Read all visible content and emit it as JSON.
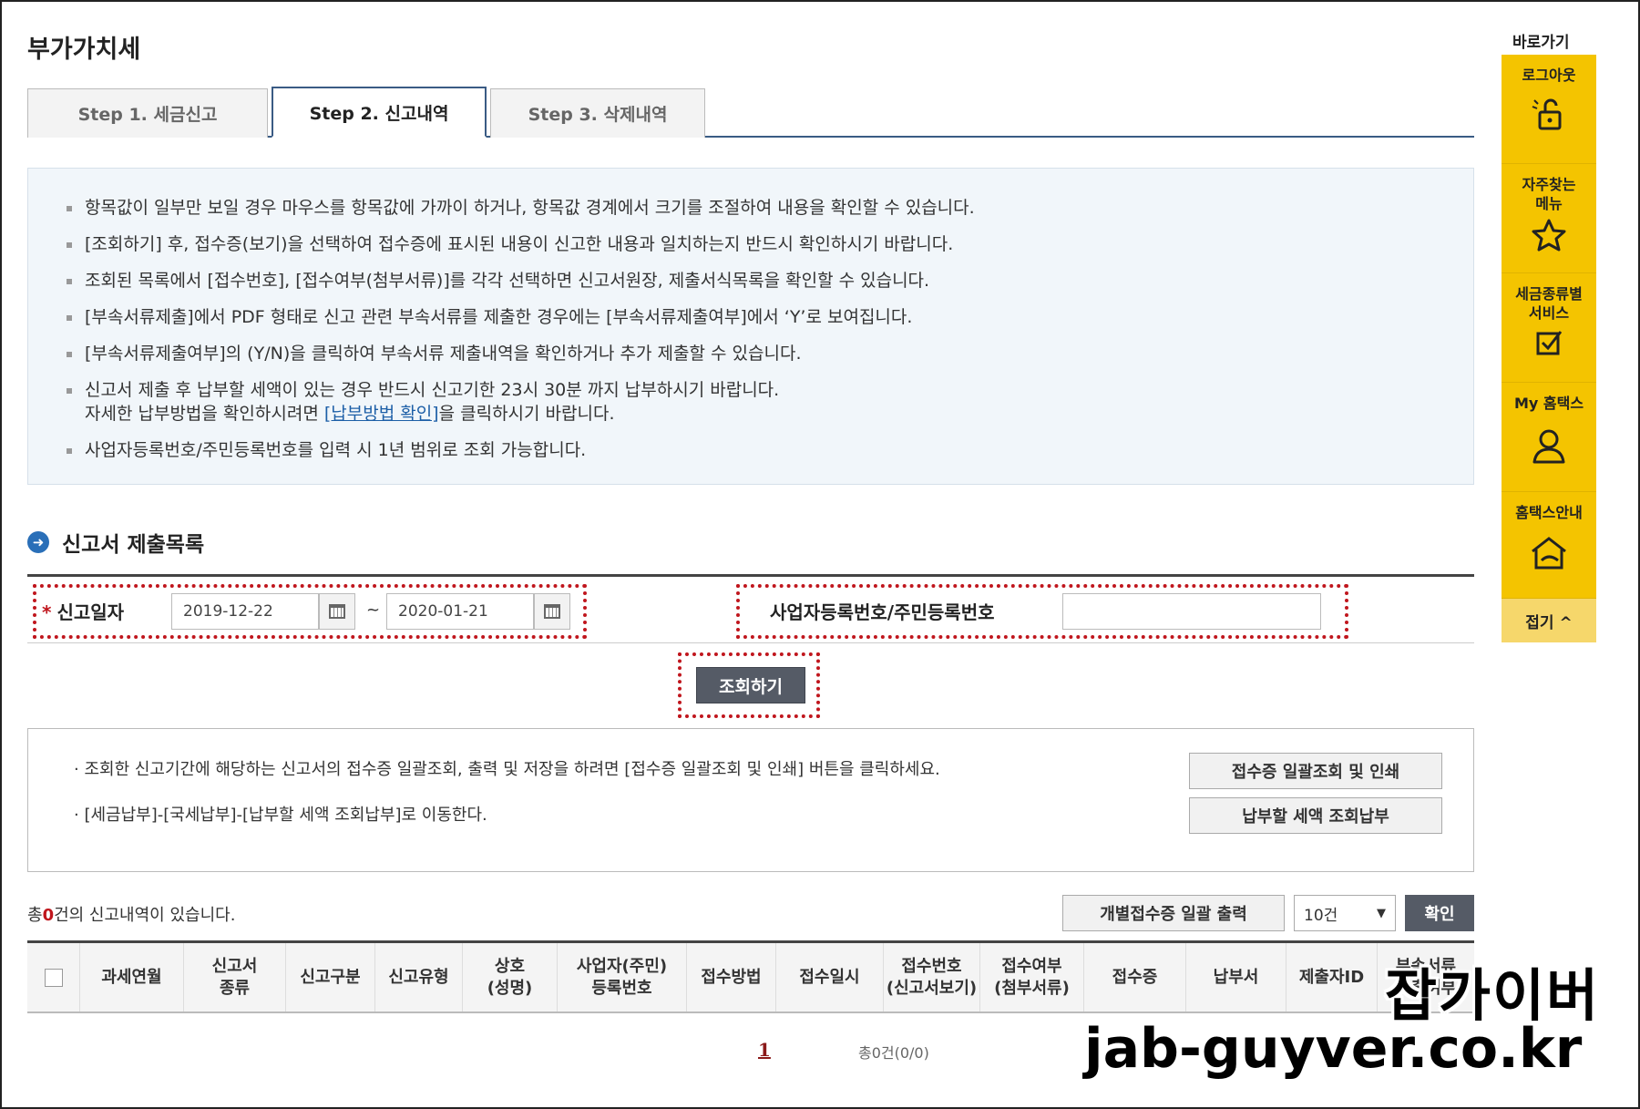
{
  "page": {
    "title": "부가가치세"
  },
  "tabs": [
    {
      "label": "Step 1. 세금신고",
      "active": false
    },
    {
      "label": "Step 2. 신고내역",
      "active": true
    },
    {
      "label": "Step 3. 삭제내역",
      "active": false
    }
  ],
  "notice": {
    "items": [
      "항목값이 일부만 보일 경우 마우스를 항목값에 가까이 하거나, 항목값 경계에서 크기를 조절하여 내용을 확인할 수 있습니다.",
      "[조회하기] 후, 접수증(보기)을 선택하여 접수증에 표시된 내용이 신고한 내용과 일치하는지 반드시 확인하시기 바랍니다.",
      "조회된 목록에서 [접수번호], [접수여부(첨부서류)]를 각각 선택하면 신고서원장, 제출서식목록을 확인할 수 있습니다.",
      "[부속서류제출]에서 PDF 형태로 신고 관련 부속서류를 제출한 경우에는 [부속서류제출여부]에서 ‘Y’로 보여집니다.",
      "[부속서류제출여부]의 (Y/N)을 클릭하여 부속서류 제출내역을 확인하거나 추가 제출할 수 있습니다.",
      "신고서 제출 후 납부할 세액이 있는 경우 반드시 신고기한 23시 30분 까지 납부하시기 바랍니다."
    ],
    "payment_line_prefix": "자세한 납부방법을 확인하시려면 ",
    "payment_link": "[납부방법 확인]",
    "payment_line_suffix": "을 클릭하시기 바랍니다.",
    "last_item": "사업자등록번호/주민등록번호를 입력 시 1년 범위로 조회 가능합니다."
  },
  "section": {
    "title": "신고서 제출목록"
  },
  "search": {
    "required_mark": "*",
    "date_label": "신고일자",
    "date_from": "2019-12-22",
    "date_to": "2020-01-21",
    "tilde": "~",
    "biz_label": "사업자등록번호/주민등록번호",
    "biz_value": "",
    "query_button": "조회하기"
  },
  "info2": {
    "line1": "· 조회한 신고기간에 해당하는 신고서의 접수증 일괄조회, 출력 및 저장을 하려면 [접수증 일괄조회 및 인쇄] 버튼을 클릭하세요.",
    "line2": "· [세금납부]-[국세납부]-[납부할 세액 조회납부]로 이동한다.",
    "btn_print": "접수증 일괄조회 및 인쇄",
    "btn_pay": "납부할 세액 조회납부"
  },
  "list": {
    "count_prefix": "총",
    "count": "0",
    "count_suffix": "건의 신고내역이 있습니다.",
    "bulk_print_button": "개별접수증 일괄 출력",
    "page_size": "10건",
    "confirm_button": "확인",
    "columns": [
      "과세연월",
      "신고서\n종류",
      "신고구분",
      "신고유형",
      "상호\n(성명)",
      "사업자(주민)\n등록번호",
      "접수방법",
      "접수일시",
      "접수번호\n(신고서보기)",
      "접수여부\n(첨부서류)",
      "접수증",
      "납부서",
      "제출자ID",
      "부속서류\n제출여부"
    ],
    "page_number": "1",
    "total_text": "총0건(0/0)"
  },
  "quick": {
    "title": "바로가기",
    "items": [
      {
        "label": "로그아웃",
        "icon": "unlock-icon"
      },
      {
        "label": "자주찾는\n메뉴",
        "icon": "star-icon"
      },
      {
        "label": "세금종류별\n서비스",
        "icon": "checkbox-icon"
      },
      {
        "label": "My 홈택스",
        "icon": "user-icon"
      },
      {
        "label": "홈택스안내",
        "icon": "home-icon"
      }
    ],
    "fold_label": "접기 ^"
  },
  "watermark": {
    "line1": "잡가이버",
    "line2": "jab-guyver.co.kr"
  },
  "colors": {
    "accent": "#3a5b84",
    "highlight": "#c0161d",
    "quick_panel": "#f4c400",
    "button_dark": "#555b66"
  }
}
